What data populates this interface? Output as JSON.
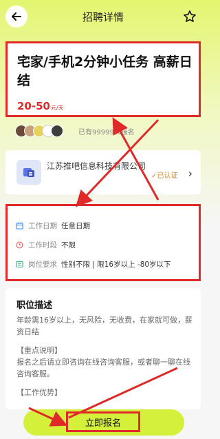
{
  "header": {
    "title": "招聘详情"
  },
  "job": {
    "title": "宅家/手机2分钟小任务 高薪日结",
    "salary": "20-50",
    "salary_unit": "元/天"
  },
  "applicants": {
    "text": "已有99999人报名"
  },
  "company": {
    "name": "江苏推吧信息科技有限公司",
    "verified": "已认证"
  },
  "info": {
    "work_date_label": "工作日期",
    "work_date_value": "任意日期",
    "work_time_label": "工作时段",
    "work_time_value": "不限",
    "requirement_label": "岗位要求",
    "requirement_value": "性别不限 | 限16岁以上 -80岁以下"
  },
  "description": {
    "title": "职位描述",
    "para1": "年龄需16岁以上，无风险，无收费，在家就可做，薪资日结",
    "section_title": "【重点说明】",
    "para2": "报名之后请立即咨询在线咨询客服，或者聊一聊在线咨询客服。",
    "section2_title": "【工作优势】"
  },
  "footer": {
    "apply_label": "立即报名"
  },
  "colors": {
    "accent": "#d5f03a",
    "highlight": "#e02a2a",
    "salary": "#e02a2a"
  }
}
